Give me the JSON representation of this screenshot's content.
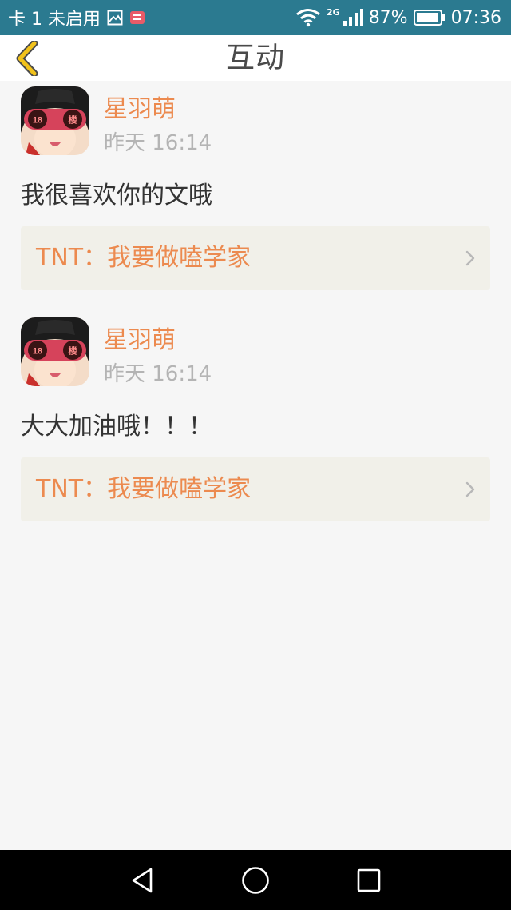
{
  "status_bar": {
    "carrier": "卡 1 未启用",
    "network_type": "2G",
    "battery": "87%",
    "time": "07:36",
    "bg_color": "#2b7a90"
  },
  "header": {
    "title": "互动",
    "back_icon": "chevron-left-icon",
    "back_color": "#f2c21b"
  },
  "feed": [
    {
      "user": "星羽萌",
      "time": "昨天 16:14",
      "text": "我很喜欢你的文哦",
      "reference": "TNT：我要做嗑学家",
      "avatar_badges": [
        "18",
        "楼"
      ]
    },
    {
      "user": "星羽萌",
      "time": "昨天 16:14",
      "text": "大大加油哦！！！",
      "reference": "TNT：我要做嗑学家",
      "avatar_badges": [
        "18",
        "楼"
      ]
    }
  ],
  "nav_bar": {
    "icons": [
      "back-triangle-icon",
      "home-circle-icon",
      "recents-square-icon"
    ]
  },
  "colors": {
    "accent": "#ec8a4f",
    "card_bg": "#f1f0e9",
    "page_bg": "#f6f6f6"
  }
}
